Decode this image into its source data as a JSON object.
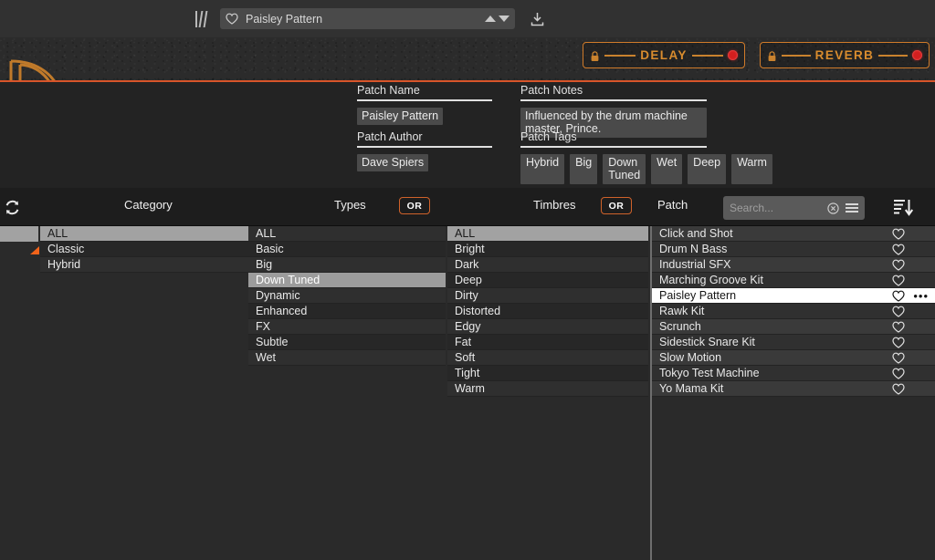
{
  "topbar": {
    "library_icon": "library-books-icon",
    "favorite_icon": "heart-icon",
    "patch_name": "Paisley Pattern",
    "up_icon": "triangle-up-icon",
    "down_icon": "triangle-down-icon",
    "download_icon": "download-icon"
  },
  "plugin_header": {
    "logo_icon": "brand-logo-icon",
    "modules": [
      {
        "label": "DELAY",
        "lock_icon": "lock-icon",
        "led_color": "#d31f1f"
      },
      {
        "label": "REVERB",
        "lock_icon": "lock-icon",
        "led_color": "#d31f1f"
      }
    ],
    "accent_color": "#d8552a"
  },
  "info": {
    "patch_name": {
      "label": "Patch Name",
      "value": "Paisley Pattern"
    },
    "patch_author": {
      "label": "Patch Author",
      "value": "Dave Spiers"
    },
    "patch_notes": {
      "label": "Patch Notes",
      "value": "Influenced by the drum machine master, Prince."
    },
    "patch_tags": {
      "label": "Patch Tags",
      "values": [
        "Hybrid",
        "Big",
        "Down Tuned",
        "Wet",
        "Deep",
        "Warm"
      ]
    }
  },
  "toolbar": {
    "refresh_icon": "refresh-icon",
    "category_label": "Category",
    "types_label": "Types",
    "timbres_label": "Timbres",
    "patch_label": "Patch",
    "or_1": "OR",
    "or_2": "OR",
    "search_placeholder": "Search...",
    "search_value": "",
    "clear_icon": "clear-circle-icon",
    "menu_icon": "hamburger-icon",
    "sort_icon": "sort-descending-icon",
    "or_border_color": "#d0622a"
  },
  "columns": {
    "category": {
      "items": [
        "ALL",
        "Classic",
        "Hybrid"
      ],
      "selected": "ALL"
    },
    "types": {
      "items": [
        "ALL",
        "Basic",
        "Big",
        "Down Tuned",
        "Dynamic",
        "Enhanced",
        "FX",
        "Subtle",
        "Wet"
      ],
      "selected": "Down Tuned"
    },
    "timbres": {
      "items": [
        "ALL",
        "Bright",
        "Dark",
        "Deep",
        "Dirty",
        "Distorted",
        "Edgy",
        "Fat",
        "Soft",
        "Tight",
        "Warm"
      ],
      "selected": "ALL"
    },
    "patch": {
      "items": [
        "Click and Shot",
        "Drum N Bass",
        "Industrial SFX",
        "Marching Groove Kit",
        "Paisley Pattern",
        "Rawk Kit",
        "Scrunch",
        "Sidestick Snare Kit",
        "Slow Motion",
        "Tokyo Test Machine",
        "Yo Mama Kit"
      ],
      "selected": "Paisley Pattern",
      "favorite_icon": "heart-icon",
      "overflow_icon": "more-options-icon",
      "overflow_label": "•••"
    }
  },
  "gutter": {
    "marker_icon": "orange-triangle-marker",
    "marker_color": "#f2631a"
  }
}
